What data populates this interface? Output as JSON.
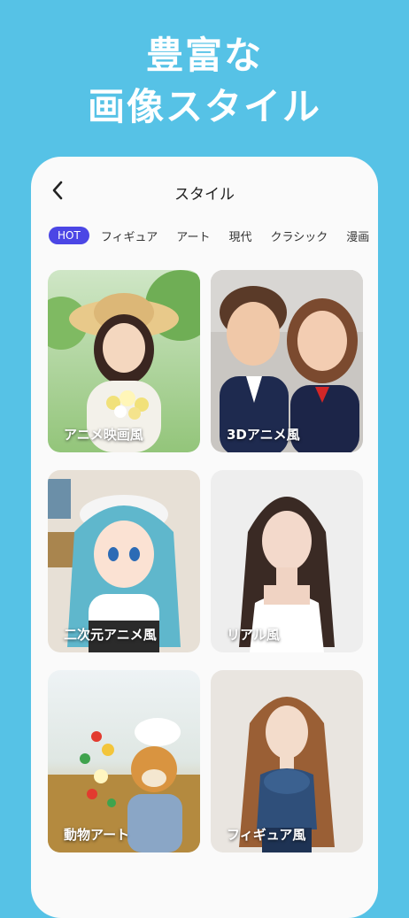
{
  "promo": {
    "line1": "豊富な",
    "line2": "画像スタイル"
  },
  "header": {
    "title": "スタイル"
  },
  "tabs": [
    {
      "label": "HOT"
    },
    {
      "label": "フィギュア"
    },
    {
      "label": "アート"
    },
    {
      "label": "現代"
    },
    {
      "label": "クラシック"
    },
    {
      "label": "漫画"
    }
  ],
  "cards": [
    {
      "label": "アニメ映画風"
    },
    {
      "label": "3Dアニメ風"
    },
    {
      "label": "二次元アニメ風"
    },
    {
      "label": "リアル風"
    },
    {
      "label": "動物アート"
    },
    {
      "label": "フィギュア風"
    }
  ],
  "colors": {
    "background": "#56c2e6",
    "accent": "#4b46e5"
  }
}
